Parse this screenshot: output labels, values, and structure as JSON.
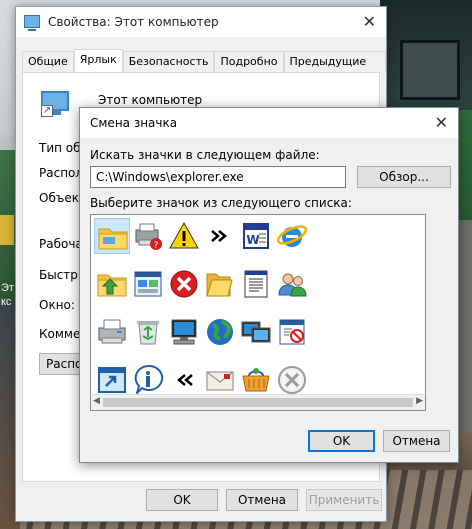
{
  "background": {
    "text_1": "Эт",
    "text_2": "кс"
  },
  "props_window": {
    "title": "Свойства: Этот компьютер",
    "tabs": [
      "Общие",
      "Ярлык",
      "Безопасность",
      "Подробно",
      "Предыдущие версии"
    ],
    "active_tab": "Ярлык",
    "name_value": "Этот компьютер",
    "labels": {
      "type": "Тип объе",
      "location": "Располо",
      "object": "Объект:",
      "workdir": "Рабочая п",
      "shortcut": "Быстрый",
      "window": "Окно:",
      "comment": "Коммент"
    },
    "location_button": "Располо",
    "ok": "OK",
    "cancel": "Отмена",
    "apply": "Применить"
  },
  "change_icon_dialog": {
    "title": "Смена значка",
    "file_label": "Искать значки в следующем файле:",
    "file_path": "C:\\Windows\\explorer.exe",
    "browse": "Обзор...",
    "list_label": "Выберите значок из следующего списка:",
    "ok": "OK",
    "cancel": "Отмена",
    "icons": [
      "folder-icon",
      "printer-error-icon",
      "warning-icon",
      "forward-arrows-icon",
      "document-icon",
      "internet-explorer-icon",
      "folder-up-icon",
      "app-window-icon",
      "error-icon",
      "folder-open-icon",
      "document-lines-icon",
      "users-icon",
      "fax-printer-icon",
      "recycle-bin-icon",
      "computer-icon",
      "globe-icon",
      "monitors-icon",
      "window-blocked-icon",
      "window-arrow-icon",
      "info-icon",
      "back-arrows-icon",
      "mail-icon",
      "shopping-basket-icon",
      "gray-x-icon"
    ],
    "selected_icon": "folder-icon"
  },
  "colors": {
    "accent": "#0078d7",
    "selection": "#cce8ff"
  }
}
